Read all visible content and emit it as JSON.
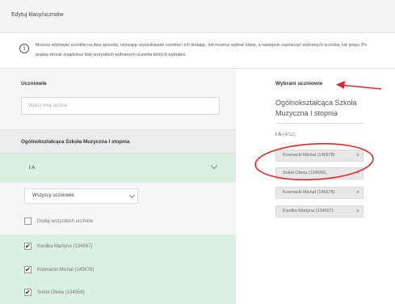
{
  "header": {
    "title": "Edytuj klasy/uczniów"
  },
  "info": {
    "icon": "info-icon",
    "text": "Możesz edytować uczniów na dwa sposoby, używając wyszukiwarki uczniów i ich dodając, lub możesz wybrać klasę, a następnie zaznaczyć wybranych uczniów, lub grupy. Po prawej stronie znajdziesz listę wszystkich wybranych uczniów których wybrałeś."
  },
  "left": {
    "title": "Uczniowie",
    "search_placeholder": "Wpisz imię ucznia",
    "school_name": "Ogólnokształcąca Szkoła Muzyczna I stopnia",
    "class_name": "I A",
    "filter_value": "Wszyscy uczniowie",
    "add_all_label": "Dodaj wszystkich uczniów",
    "students": [
      {
        "name": "Kwolka Martyna (134567)",
        "checked": true
      },
      {
        "name": "Kownacki Michał (145678)",
        "checked": true
      },
      {
        "name": "Sokół Oliwia (134556)",
        "checked": true
      }
    ]
  },
  "right": {
    "title": "Wybrani uczniowie",
    "school_name": "Ogólnokształcąca Szkoła Muzyczna I stopnia",
    "class_name": "I A",
    "class_count": "(4/11)",
    "chips": [
      {
        "label": "Kownacki Michał (145678)"
      },
      {
        "label": "Sokół Oliwia (134556)"
      },
      {
        "label": "Kownacki Michał (145678)"
      },
      {
        "label": "Kwolka Martyna (134567)"
      }
    ]
  },
  "colors": {
    "selected_row": "#d9f0e2",
    "panel_bg": "#f6f6f6",
    "annotation": "#e02a2a"
  }
}
